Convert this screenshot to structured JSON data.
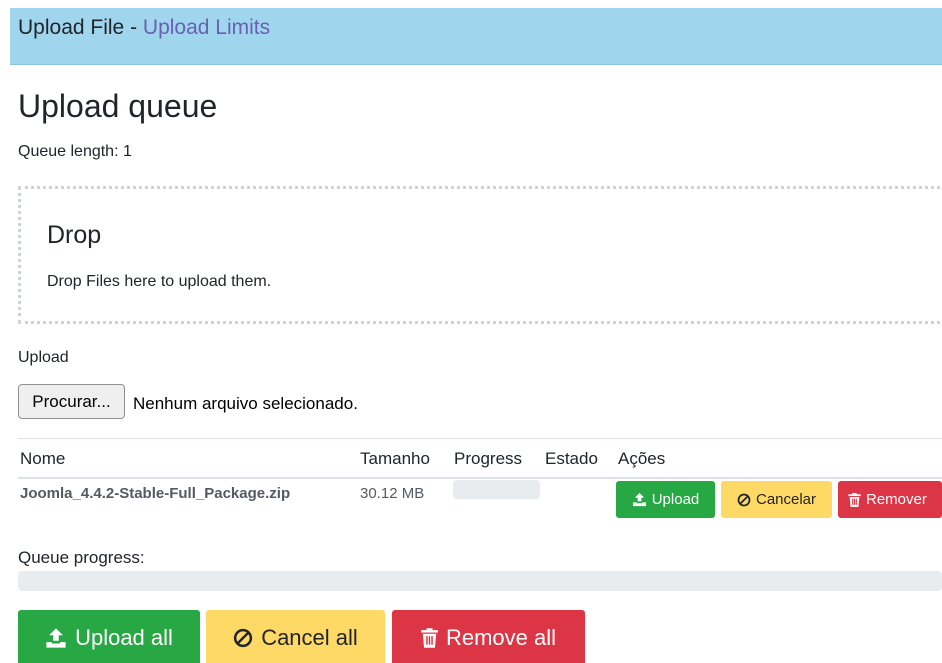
{
  "header": {
    "title": "Upload File",
    "separator": "-",
    "link": "Upload Limits"
  },
  "queue": {
    "title": "Upload queue",
    "length_text": "Queue length: 1"
  },
  "dropzone": {
    "title": "Drop",
    "text": "Drop Files here to upload them."
  },
  "upload": {
    "label": "Upload",
    "browse_button": "Procurar...",
    "file_status": "Nenhum arquivo selecionado."
  },
  "table": {
    "headers": [
      "Nome",
      "Tamanho",
      "Progress",
      "Estado",
      "Ações"
    ],
    "rows": [
      {
        "name": "Joomla_4.4.2-Stable-Full_Package.zip",
        "size": "30.12 MB",
        "progress": 0,
        "status": "",
        "actions": {
          "upload": "Upload",
          "cancel": "Cancelar",
          "remove": "Remover"
        }
      }
    ]
  },
  "queue_progress": {
    "label": "Queue progress:",
    "value": 0
  },
  "bulk_actions": {
    "upload_all": "Upload all",
    "cancel_all": "Cancel all",
    "remove_all": "Remove all"
  },
  "icons": {
    "upload": "upload-icon",
    "cancel": "ban-icon",
    "remove": "trash-icon"
  },
  "colors": {
    "header_bg": "#9fd6ee",
    "link": "#6a5fb0",
    "success": "#28a745",
    "warning": "#ffd966",
    "danger": "#dc3545"
  }
}
